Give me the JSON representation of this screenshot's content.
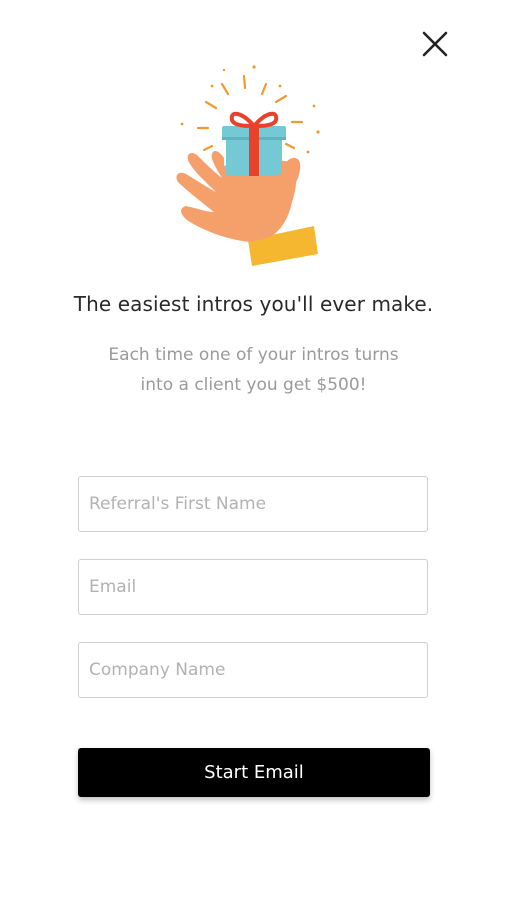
{
  "modal": {
    "close_icon": "close-icon",
    "illustration_icon": "hand-holding-gift-icon",
    "headline": "The easiest intros you'll ever make.",
    "subtext_line1": "Each time one of your intros turns",
    "subtext_line2": "into a client you get $500!"
  },
  "form": {
    "first_name": {
      "placeholder": "Referral's First Name",
      "value": ""
    },
    "email": {
      "placeholder": "Email",
      "value": ""
    },
    "company": {
      "placeholder": "Company Name",
      "value": ""
    },
    "submit_label": "Start Email"
  },
  "colors": {
    "button_bg": "#000000",
    "button_text": "#ffffff",
    "headline": "#2a2a2a",
    "subtext": "#9a9a9a",
    "field_border": "#cfcfcf",
    "placeholder": "#b2b2b2",
    "gift_box": "#74c9d4",
    "gift_ribbon": "#e8412c",
    "hand": "#f5a06a",
    "sleeve": "#f4b72f",
    "sparkles": "#f29a2e"
  }
}
